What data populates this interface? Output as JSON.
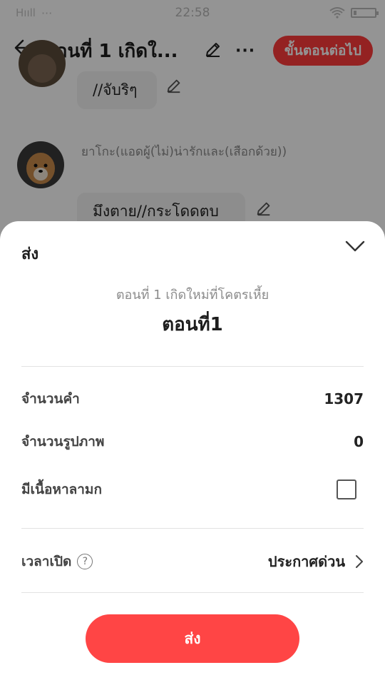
{
  "status_bar": {
    "time": "22:58"
  },
  "header": {
    "title": "ตอนที่ 1 เกิดใ...",
    "next_label": "ขั้นตอนต่อไป",
    "more_label": "···"
  },
  "chat": {
    "first_bubble": "//จับริๆ",
    "second_character": "ยาโกะ(แอดผู้(ไม่)น่ารักและ(เสือกด้วย))",
    "second_bubble": "มึงตาย//กระโดดตบ"
  },
  "sheet": {
    "title": "ส่ง",
    "work_title": "ตอนที่ 1 เกิดใหม่ที่โคตรเหี้ย",
    "chapter_title": "ตอนที่1",
    "word_count_label": "จำนวนคำ",
    "word_count_value": "1307",
    "image_count_label": "จำนวนรูปภาพ",
    "image_count_value": "0",
    "mature_label": "มีเนื้อหาลามก",
    "mature_checked": false,
    "publish_time_label": "เวลาเปิด",
    "publish_time_value": "ประกาศด่วน",
    "help_icon": "?",
    "send_label": "ส่ง"
  },
  "colors": {
    "accent": "#ff4545",
    "next_button": "#ff3b3b"
  }
}
